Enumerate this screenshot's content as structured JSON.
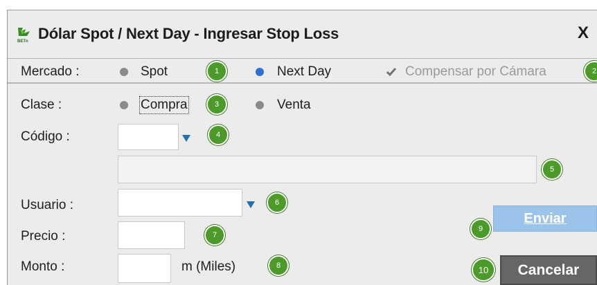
{
  "window": {
    "title": "Dólar Spot / Next Day - Ingresar Stop Loss",
    "logo_text": "BETn",
    "close_label": "X"
  },
  "mercado": {
    "label": "Mercado :",
    "options": [
      "Spot",
      "Next Day"
    ],
    "selected": "Next Day",
    "compensar_label": "Compensar por Cámara",
    "compensar_checked": true
  },
  "clase": {
    "label": "Clase :",
    "options": [
      "Compra",
      "Venta"
    ]
  },
  "codigo": {
    "label": "Código :",
    "value": "",
    "description": ""
  },
  "usuario": {
    "label": "Usuario :",
    "value": ""
  },
  "precio": {
    "label": "Precio :",
    "value": ""
  },
  "monto": {
    "label": "Monto :",
    "value": "",
    "unit": "m (Miles)"
  },
  "buttons": {
    "enviar": "Enviar",
    "cancelar": "Cancelar"
  },
  "badges": [
    "1",
    "2",
    "3",
    "4",
    "5",
    "6",
    "7",
    "8",
    "9",
    "10"
  ],
  "colors": {
    "badge": "#4c9a2a",
    "radio_selected": "#2f6fcf",
    "enviar_bg": "#9cc3ea",
    "cancelar_bg": "#666666"
  }
}
